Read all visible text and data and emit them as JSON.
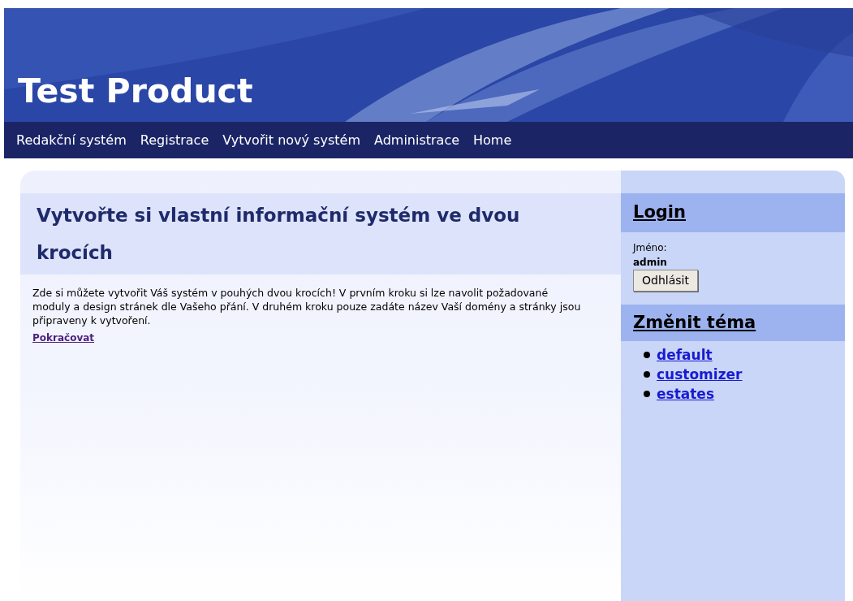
{
  "header": {
    "title": "Test Product"
  },
  "nav": [
    {
      "label": "Redakční systém"
    },
    {
      "label": "Registrace"
    },
    {
      "label": "Vytvořit nový systém"
    },
    {
      "label": "Administrace"
    },
    {
      "label": "Home"
    }
  ],
  "main": {
    "heading": "Vytvořte si vlastní informační systém ve dvou krocích",
    "text": "Zde si můžete vytvořit Váš systém v pouhých dvou krocích! V prvním kroku si lze navolit požadované moduly a design stránek dle Vašeho přání. V druhém kroku pouze zadáte název Vaší domény a stránky jsou připraveny k vytvoření.",
    "link": "Pokračovat"
  },
  "sidebar": {
    "login": {
      "heading": "Login",
      "name_label": "Jméno:",
      "name_value": "admin",
      "button": "Odhlásit"
    },
    "theme": {
      "heading": "Změnit téma",
      "items": [
        {
          "label": "default"
        },
        {
          "label": "customizer"
        },
        {
          "label": "estates"
        }
      ]
    }
  }
}
